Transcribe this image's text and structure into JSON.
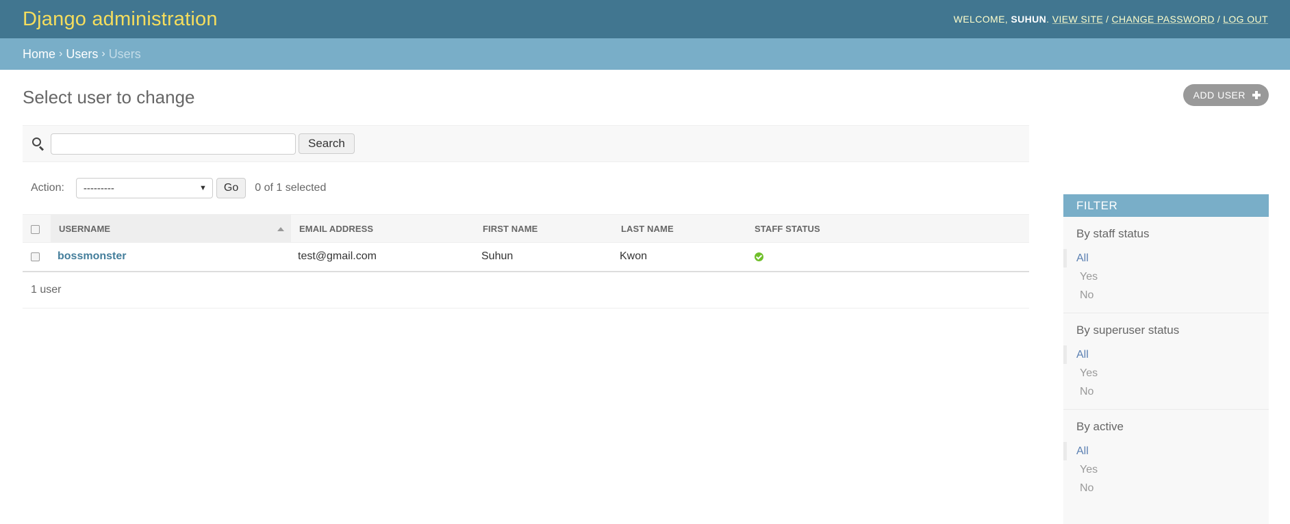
{
  "header": {
    "branding": "Django administration",
    "welcome": "Welcome, ",
    "username": "suhun",
    "view_site": "View site",
    "change_password": "Change password",
    "log_out": "Log out"
  },
  "breadcrumbs": {
    "home": "Home",
    "app": "Users",
    "current": "Users",
    "separator": "›"
  },
  "page": {
    "title": "Select user to change",
    "add_button": "Add user"
  },
  "search": {
    "value": "",
    "button": "Search"
  },
  "actions": {
    "label": "Action:",
    "selected_option": "---------",
    "go": "Go",
    "counter": "0 of 1 selected"
  },
  "table": {
    "columns": [
      "Username",
      "Email address",
      "First name",
      "Last name",
      "Staff status"
    ],
    "sorted_column": "Username",
    "rows": [
      {
        "username": "bossmonster",
        "email": "test@gmail.com",
        "first_name": "Suhun",
        "last_name": "Kwon",
        "staff_status": true
      }
    ]
  },
  "paginator": "1 user",
  "filter": {
    "title": "Filter",
    "groups": [
      {
        "title": "By staff status",
        "options": [
          "All",
          "Yes",
          "No"
        ],
        "selected": "All"
      },
      {
        "title": "By superuser status",
        "options": [
          "All",
          "Yes",
          "No"
        ],
        "selected": "All"
      },
      {
        "title": "By active",
        "options": [
          "All",
          "Yes",
          "No"
        ],
        "selected": "All"
      }
    ]
  },
  "colors": {
    "header_bg": "#417690",
    "breadcrumb_bg": "#79aec8",
    "branding": "#f5dd5d",
    "link": "#447e9b",
    "filter_selected": "#5b80b2",
    "staff_yes": "#70bf2b"
  },
  "icons": {
    "search": "search-icon",
    "add": "plus-icon",
    "staff_yes": "check-circle-icon",
    "sort": "sort-ascending-icon"
  }
}
